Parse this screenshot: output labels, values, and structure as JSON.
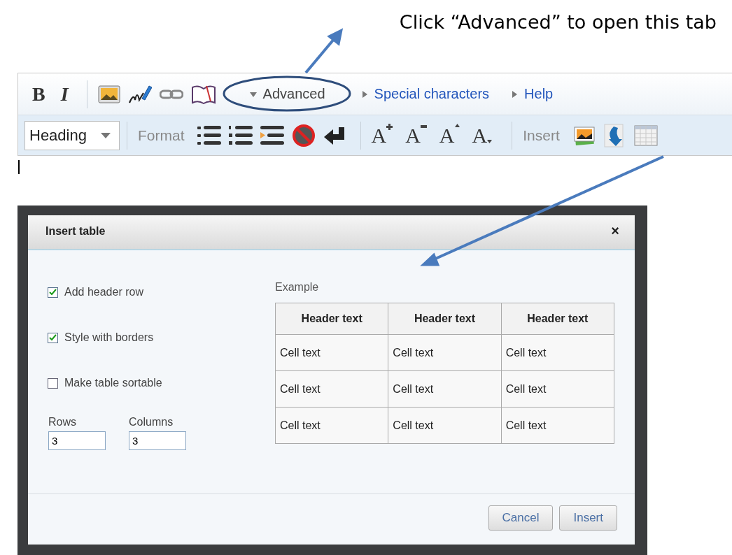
{
  "annotation": {
    "text": "Click “Advanced” to open this tab"
  },
  "toolbar": {
    "bold": "B",
    "italic": "I",
    "tabs": [
      {
        "label": "Advanced",
        "expanded": true
      },
      {
        "label": "Special characters",
        "expanded": false
      },
      {
        "label": "Help",
        "expanded": false
      }
    ],
    "heading_select": "Heading",
    "format_label": "Format",
    "size_buttons": [
      {
        "label": "A",
        "kind": "bigger"
      },
      {
        "label": "A",
        "kind": "smaller"
      },
      {
        "label": "A",
        "kind": "superscript"
      },
      {
        "label": "A",
        "kind": "subscript"
      }
    ],
    "insert_label": "Insert"
  },
  "dialog": {
    "title": "Insert table",
    "close": "×",
    "options": [
      {
        "label": "Add header row",
        "checked": true
      },
      {
        "label": "Style with borders",
        "checked": true
      },
      {
        "label": "Make table sortable",
        "checked": false
      }
    ],
    "rows": {
      "label": "Rows",
      "value": "3"
    },
    "columns": {
      "label": "Columns",
      "value": "3"
    },
    "example": {
      "label": "Example",
      "header": [
        "Header text",
        "Header text",
        "Header text"
      ],
      "rows": [
        [
          "Cell text",
          "Cell text",
          "Cell text"
        ],
        [
          "Cell text",
          "Cell text",
          "Cell text"
        ],
        [
          "Cell text",
          "Cell text",
          "Cell text"
        ]
      ]
    },
    "buttons": [
      "Cancel",
      "Insert"
    ]
  }
}
